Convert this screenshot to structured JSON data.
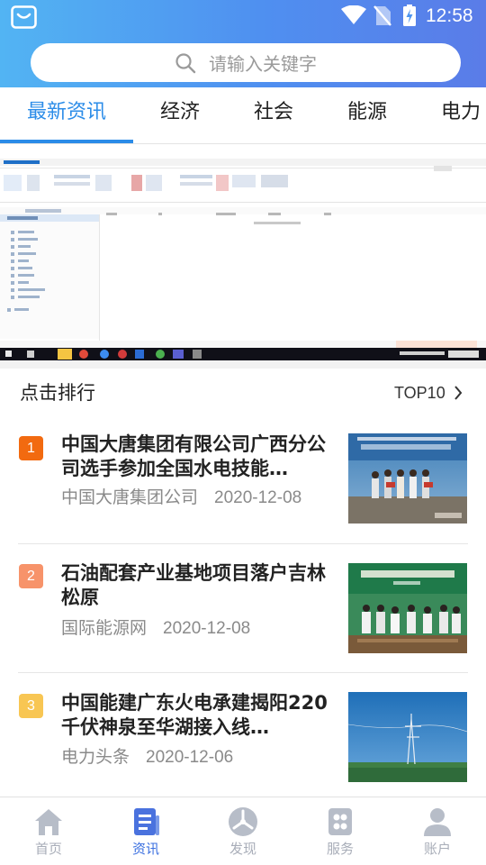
{
  "status_bar": {
    "time": "12:58",
    "icons": [
      "app-notification-icon",
      "wifi-signal-icon",
      "no-sim-icon",
      "battery-charging-icon"
    ]
  },
  "search": {
    "placeholder": "请输入关键字"
  },
  "tabs": [
    {
      "label": "最新资讯",
      "active": true
    },
    {
      "label": "经济",
      "active": false
    },
    {
      "label": "社会",
      "active": false
    },
    {
      "label": "能源",
      "active": false
    },
    {
      "label": "电力",
      "active": false
    }
  ],
  "banner": {
    "slide_count": 5,
    "active_index": 0
  },
  "ranking": {
    "title": "点击排行",
    "more_label": "TOP10"
  },
  "articles": [
    {
      "rank": "1",
      "title": "中国大唐集团有限公司广西分公司选手参加全国水电技能…",
      "source": "中国大唐集团公司",
      "date": "2020-12-08",
      "badge_color": "#f26a10"
    },
    {
      "rank": "2",
      "title": "石油配套产业基地项目落户吉林松原",
      "source": "国际能源网",
      "date": "2020-12-08",
      "badge_color": "#f7936a"
    },
    {
      "rank": "3",
      "title": "中国能建广东火电承建揭阳220千伏神泉至华湖接入线…",
      "source": "电力头条",
      "date": "2020-12-06",
      "badge_color": "#f8c653"
    }
  ],
  "bottom_nav": [
    {
      "label": "首页",
      "icon": "home-icon",
      "active": false
    },
    {
      "label": "资讯",
      "icon": "news-icon",
      "active": true
    },
    {
      "label": "发现",
      "icon": "discover-icon",
      "active": false
    },
    {
      "label": "服务",
      "icon": "service-icon",
      "active": false
    },
    {
      "label": "账户",
      "icon": "account-icon",
      "active": false
    }
  ],
  "colors": {
    "accent": "#2b8ce8",
    "nav_active": "#3a6fe0",
    "header_gradient": [
      "#52b4f3",
      "#5a7ce8"
    ]
  }
}
